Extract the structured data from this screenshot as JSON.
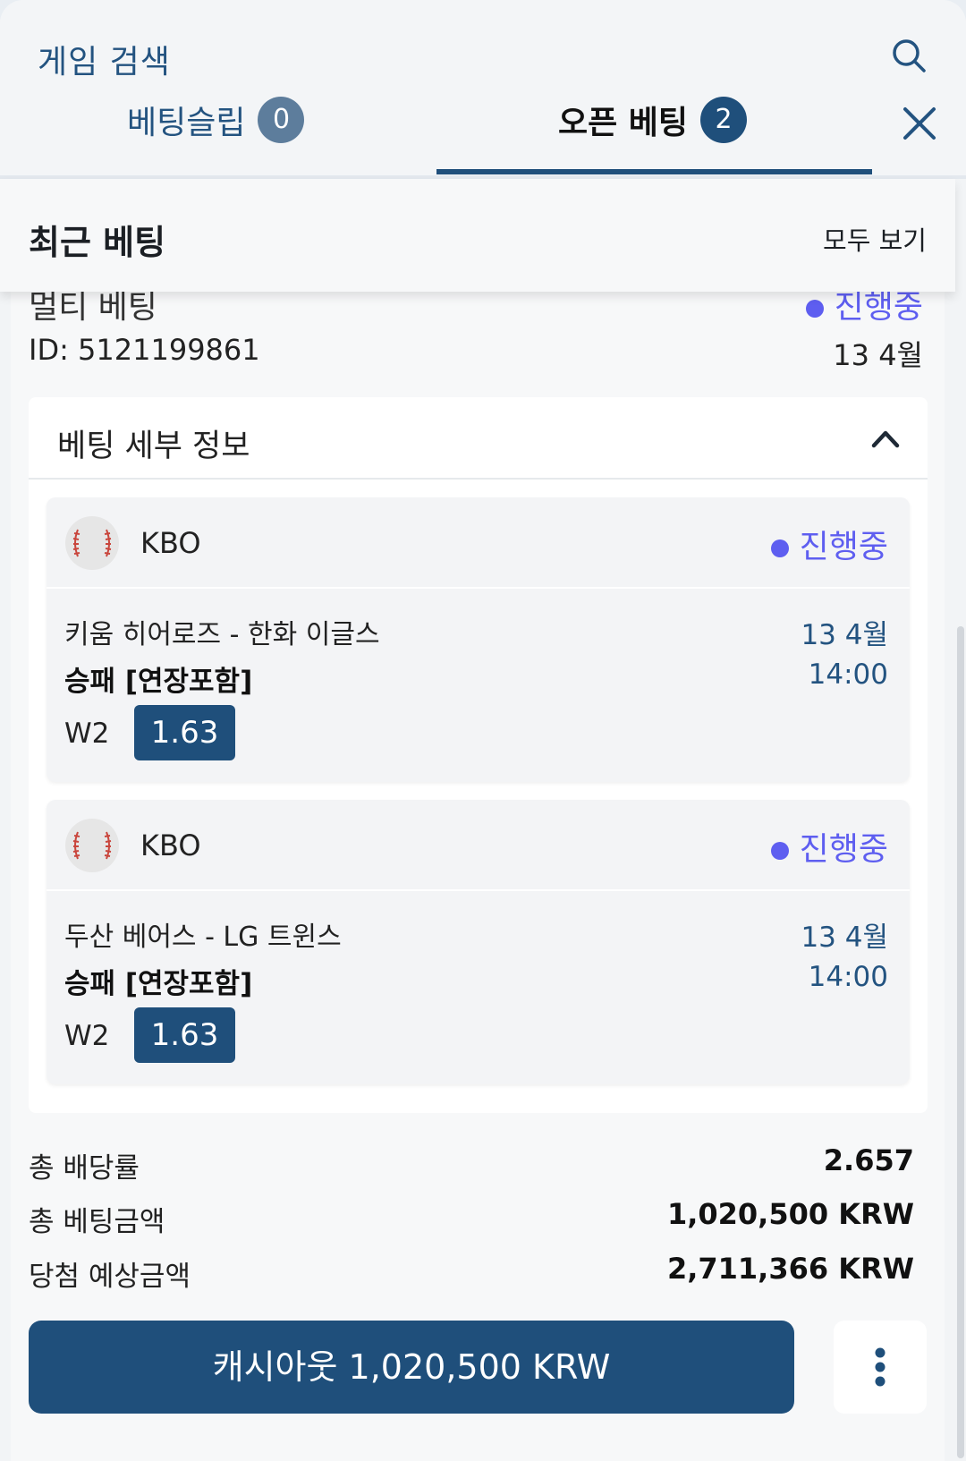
{
  "header": {
    "search_label": "게임 검색",
    "tabs": [
      {
        "label": "베팅슬립",
        "count": "0"
      },
      {
        "label": "오픈 베팅",
        "count": "2"
      }
    ]
  },
  "recent": {
    "title": "최근 베팅",
    "view_all": "모두 보기"
  },
  "bet": {
    "type": "멀티 베팅",
    "status": "진행중",
    "id": "ID: 5121199861",
    "date": "13 4월",
    "details_title": "베팅 세부 정보",
    "selections": [
      {
        "league": "KBO",
        "status": "진행중",
        "match": "키움 히어로즈 - 한화 이글스",
        "date": "13 4월",
        "market": "승패 [연장포함]",
        "time": "14:00",
        "outcome": "W2",
        "odds": "1.63"
      },
      {
        "league": "KBO",
        "status": "진행중",
        "match": "두산 베어스 - LG 트윈스",
        "date": "13 4월",
        "market": "승패 [연장포함]",
        "time": "14:00",
        "outcome": "W2",
        "odds": "1.63"
      }
    ],
    "summary": {
      "total_odds_label": "총 배당률",
      "total_odds": "2.657",
      "total_stake_label": "총 베팅금액",
      "total_stake": "1,020,500 KRW",
      "potential_win_label": "당첨 예상금액",
      "potential_win": "2,711,366 KRW"
    },
    "cashout_label": "캐시아웃 1,020,500 KRW"
  },
  "icons": {
    "search": "search-icon",
    "close": "close-icon",
    "chevron": "chevron-up-icon",
    "sport": "baseball-icon",
    "more": "more-vertical-icon"
  },
  "colors": {
    "primary": "#1f4f7b",
    "status": "#5e5ef0",
    "text_link": "#235380"
  }
}
